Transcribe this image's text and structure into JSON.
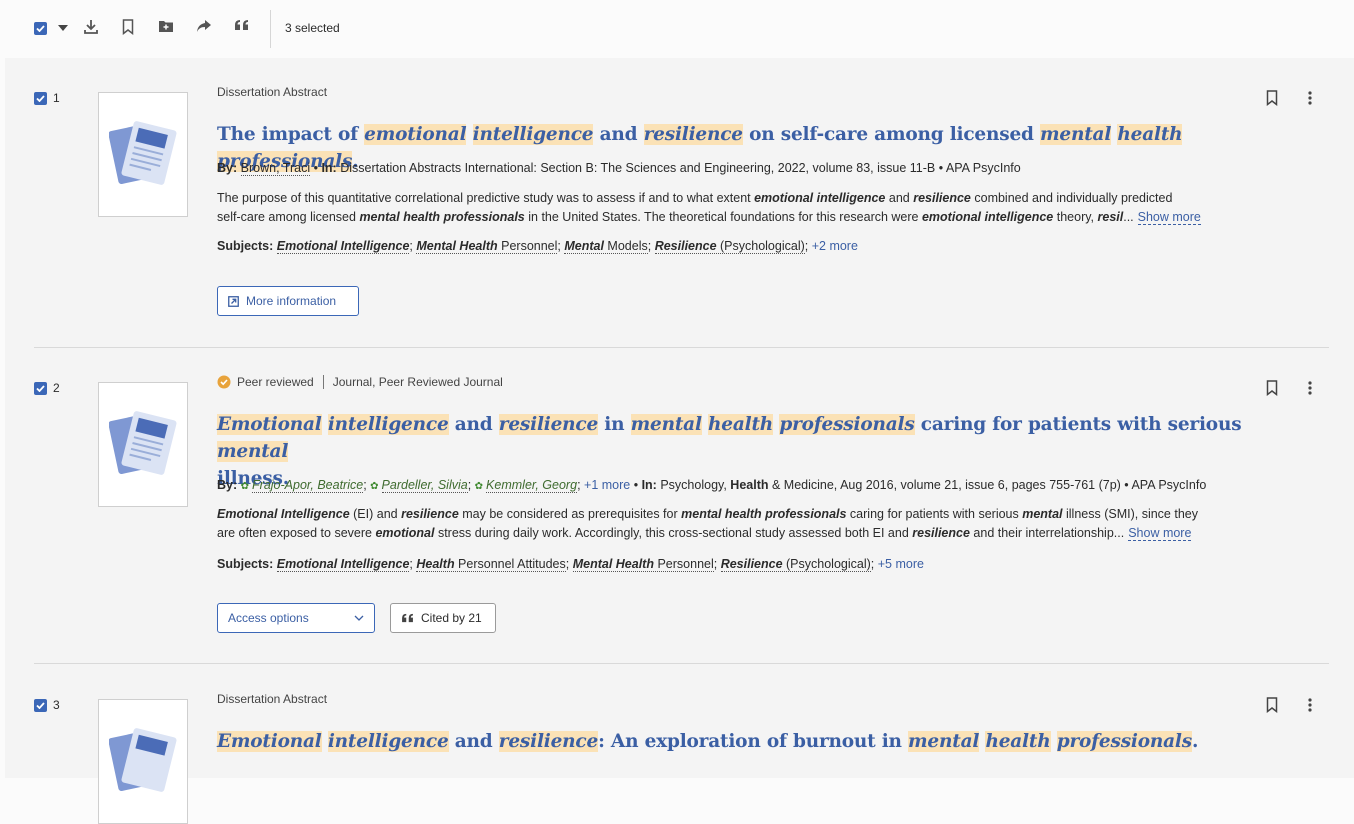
{
  "toolbar": {
    "selected_text": "3 selected",
    "icons": [
      "select-all-checkbox",
      "dropdown-caret",
      "download-icon",
      "bookmark-icon",
      "add-folder-icon",
      "share-icon",
      "cite-icon"
    ]
  },
  "colors": {
    "accent": "#3b67b7",
    "title": "#3b5fa4",
    "highlight": "#fbe2b6",
    "peer_badge": "#e8a33b"
  },
  "results": [
    {
      "num": "1",
      "pubtype": "Dissertation Abstract",
      "title_parts": [
        {
          "t": "The impact of ",
          "h": false
        },
        {
          "t": "emotional",
          "h": true
        },
        {
          "t": " ",
          "h": false
        },
        {
          "t": "intelligence",
          "h": true
        },
        {
          "t": " and ",
          "h": false
        },
        {
          "t": "resilience",
          "h": true
        },
        {
          "t": " on self-care among licensed ",
          "h": false
        },
        {
          "t": "mental",
          "h": true
        },
        {
          "t": " ",
          "h": false
        },
        {
          "t": "health",
          "h": true
        },
        {
          "t": " ",
          "h": false
        },
        {
          "t": "professionals",
          "h": true
        },
        {
          "t": ".",
          "h": false
        }
      ],
      "by_label": "By:",
      "authors": [
        "Brown, Traci"
      ],
      "in_label": "In:",
      "source": "Dissertation Abstracts International: Section B: The Sciences and Engineering, 2022, volume 83, issue 11-B",
      "database": "APA PsycInfo",
      "abstract_line1": [
        {
          "t": "The purpose of this quantitative correlational predictive study was to assess if and to what extent ",
          "b": false
        },
        {
          "t": "emotional intelligence",
          "b": true
        },
        {
          "t": " and ",
          "b": false
        },
        {
          "t": "resilience",
          "b": true
        },
        {
          "t": " combined and individually predicted",
          "b": false
        }
      ],
      "abstract_line2": [
        {
          "t": "self-care among licensed ",
          "b": false
        },
        {
          "t": "mental health professionals",
          "b": true
        },
        {
          "t": " in the United States. The theoretical foundations for this research were ",
          "b": false
        },
        {
          "t": "emotional intelligence",
          "b": true
        },
        {
          "t": " theory, ",
          "b": false
        },
        {
          "t": "resil",
          "b": true
        },
        {
          "t": "...",
          "b": false
        }
      ],
      "show_more": "Show more",
      "subjects_label": "Subjects:",
      "subjects": [
        [
          {
            "t": "Emotional Intelligence",
            "b": true
          }
        ],
        [
          {
            "t": "Mental Health",
            "b": true
          },
          {
            "t": " Personnel",
            "b": false
          }
        ],
        [
          {
            "t": "Mental",
            "b": true
          },
          {
            "t": " Models",
            "b": false
          }
        ],
        [
          {
            "t": "Resilience",
            "b": true
          },
          {
            "t": " (Psychological)",
            "b": false
          }
        ]
      ],
      "more_subjects": "+2 more",
      "button": "More information"
    },
    {
      "num": "2",
      "peer_reviewed": "Peer reviewed",
      "pubtype": "Journal, Peer Reviewed Journal",
      "title_line1": [
        {
          "t": "Emotional",
          "h": true
        },
        {
          "t": " ",
          "h": false
        },
        {
          "t": "intelligence",
          "h": true
        },
        {
          "t": " and ",
          "h": false
        },
        {
          "t": "resilience",
          "h": true
        },
        {
          "t": " in ",
          "h": false
        },
        {
          "t": "mental",
          "h": true
        },
        {
          "t": " ",
          "h": false
        },
        {
          "t": "health",
          "h": true
        },
        {
          "t": " ",
          "h": false
        },
        {
          "t": "professionals",
          "h": true
        },
        {
          "t": " caring for patients with serious ",
          "h": false
        },
        {
          "t": "mental",
          "h": true
        }
      ],
      "title_line2": [
        {
          "t": "illness.",
          "h": false
        }
      ],
      "by_label": "By:",
      "authors": [
        "Frajo-Apor, Beatrice",
        "Pardeller, Silvia",
        "Kemmler, Georg"
      ],
      "more_authors": "+1 more",
      "in_label": "In:",
      "source_parts": [
        {
          "t": "Psychology, ",
          "b": false
        },
        {
          "t": "Health",
          "b": true
        },
        {
          "t": " & Medicine, Aug 2016, volume 21, issue 6, pages 755-761 (7p)",
          "b": false
        }
      ],
      "database": "APA PsycInfo",
      "abstract_line1": [
        {
          "t": "Emotional Intelligence",
          "b": true
        },
        {
          "t": " (EI) and ",
          "b": false
        },
        {
          "t": "resilience",
          "b": true
        },
        {
          "t": " may be considered as prerequisites for ",
          "b": false
        },
        {
          "t": "mental health professionals",
          "b": true
        },
        {
          "t": " caring for patients with serious ",
          "b": false
        },
        {
          "t": "mental",
          "b": true
        },
        {
          "t": " illness (SMI), since they",
          "b": false
        }
      ],
      "abstract_line2": [
        {
          "t": "are often exposed to severe ",
          "b": false
        },
        {
          "t": "emotional",
          "b": true
        },
        {
          "t": " stress during daily work. Accordingly, this cross-sectional study assessed both EI and ",
          "b": false
        },
        {
          "t": "resilience",
          "b": true
        },
        {
          "t": " and their interrelationship...",
          "b": false
        }
      ],
      "show_more": "Show more",
      "subjects_label": "Subjects:",
      "subjects": [
        [
          {
            "t": "Emotional Intelligence",
            "b": true
          }
        ],
        [
          {
            "t": "Health",
            "b": true
          },
          {
            "t": " Personnel Attitudes",
            "b": false
          }
        ],
        [
          {
            "t": "Mental Health",
            "b": true
          },
          {
            "t": " Personnel",
            "b": false
          }
        ],
        [
          {
            "t": "Resilience",
            "b": true
          },
          {
            "t": " (Psychological)",
            "b": false
          }
        ]
      ],
      "more_subjects": "+5 more",
      "access_button": "Access options",
      "cited_button": "Cited by 21"
    },
    {
      "num": "3",
      "pubtype": "Dissertation Abstract",
      "title_parts": [
        {
          "t": "Emotional",
          "h": true
        },
        {
          "t": " ",
          "h": false
        },
        {
          "t": "intelligence",
          "h": true
        },
        {
          "t": " and ",
          "h": false
        },
        {
          "t": "resilience",
          "h": true
        },
        {
          "t": ": An exploration of burnout in ",
          "h": false
        },
        {
          "t": "mental",
          "h": true
        },
        {
          "t": " ",
          "h": false
        },
        {
          "t": "health",
          "h": true
        },
        {
          "t": " ",
          "h": false
        },
        {
          "t": "professionals",
          "h": true
        },
        {
          "t": ".",
          "h": false
        }
      ]
    }
  ]
}
